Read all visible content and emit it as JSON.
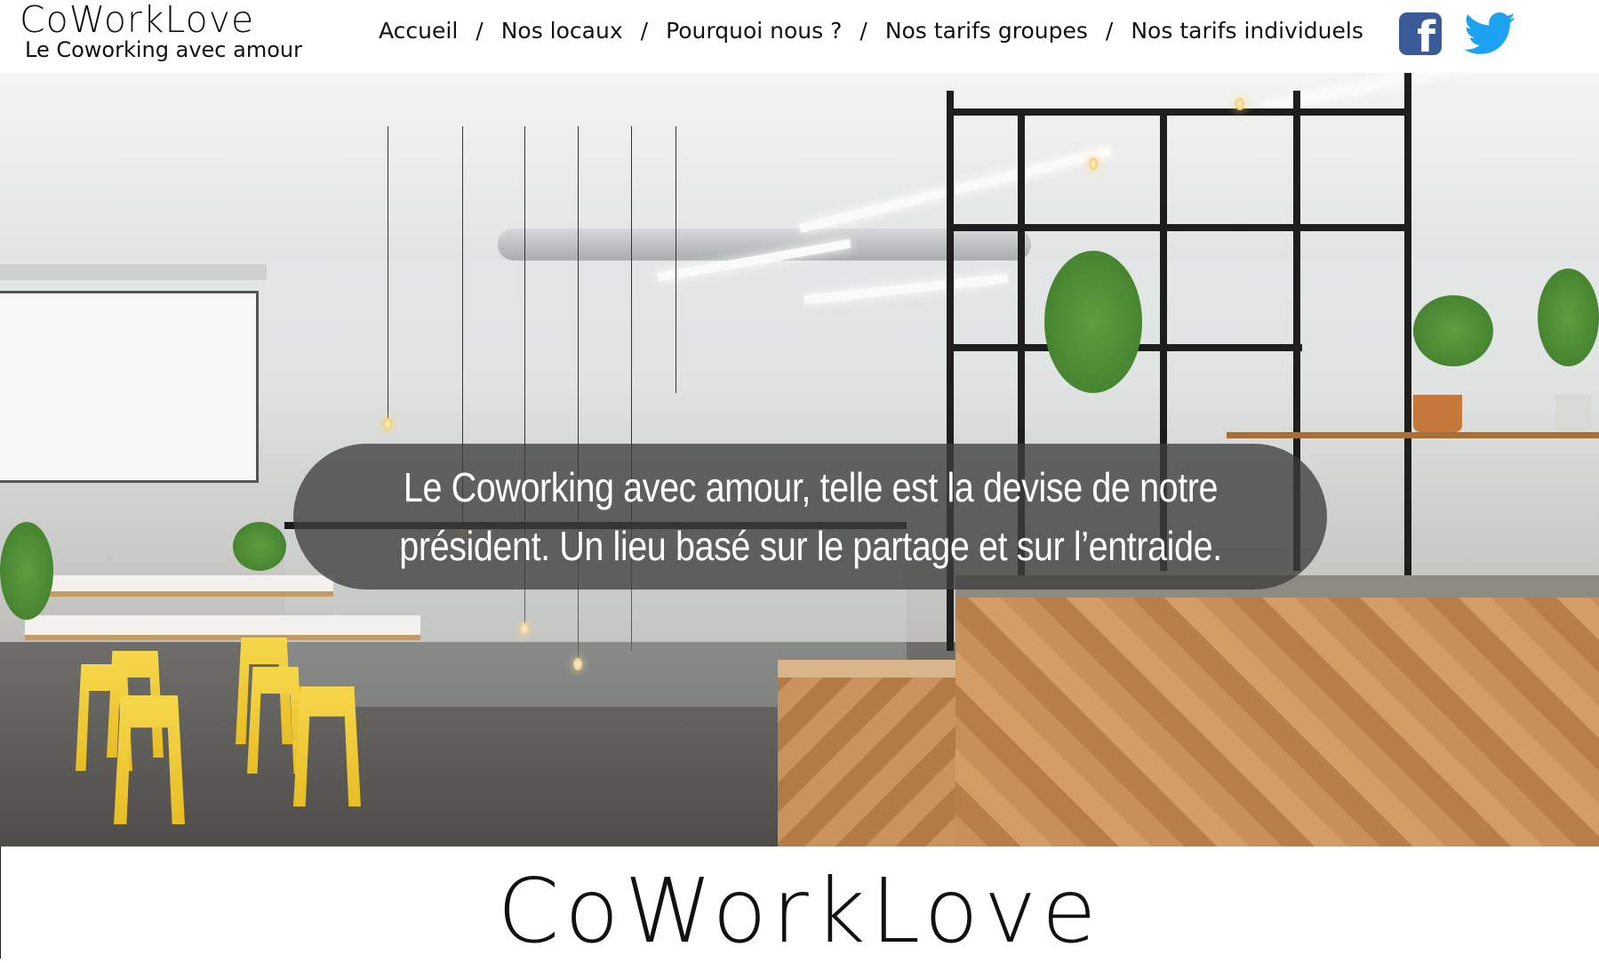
{
  "brand": {
    "name": "CoWorkLove",
    "tagline": "Le Coworking avec amour"
  },
  "nav": {
    "items": [
      {
        "label": "Accueil"
      },
      {
        "label": "Nos locaux"
      },
      {
        "label": "Pourquoi nous ?"
      },
      {
        "label": "Nos tarifs groupes"
      },
      {
        "label": "Nos tarifs individuels"
      }
    ],
    "separator": "/"
  },
  "social": {
    "facebook_icon": "facebook-icon",
    "twitter_icon": "twitter-icon",
    "facebook_color": "#3b5b98",
    "twitter_color": "#1da1f2"
  },
  "hero": {
    "image": "coworking-space-photo",
    "quote": "Le Coworking avec amour, telle est la devise de notre président. Un lieu basé sur le partage et sur l’entraide."
  },
  "footer": {
    "logo": "CoWorkLove"
  }
}
